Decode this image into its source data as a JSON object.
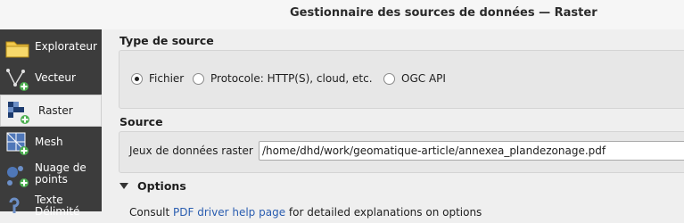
{
  "window": {
    "title": "Gestionnaire des sources de données — Raster"
  },
  "sidebar": {
    "items": [
      {
        "label": "Explorateur",
        "icon": "folder-icon",
        "selected": false
      },
      {
        "label": "Vecteur",
        "icon": "vector-layer-icon",
        "selected": false
      },
      {
        "label": "Raster",
        "icon": "raster-layer-icon",
        "selected": true
      },
      {
        "label": "Mesh",
        "icon": "mesh-layer-icon",
        "selected": false
      },
      {
        "label_line1": "Nuage de",
        "label_line2": "points",
        "icon": "point-cloud-icon",
        "selected": false
      },
      {
        "label_line1": "Texte",
        "label_line2": "Délimité",
        "icon": "delimited-text-icon",
        "selected": false
      }
    ]
  },
  "source_type": {
    "title": "Type de source",
    "options": [
      {
        "label": "Fichier",
        "checked": true
      },
      {
        "label": "Protocole: HTTP(S), cloud, etc.",
        "checked": false
      },
      {
        "label": "OGC API",
        "checked": false
      }
    ]
  },
  "source": {
    "title": "Source",
    "dataset_label": "Jeux de données raster",
    "dataset_value": "/home/dhd/work/geomatique-article/annexea_plandezonage.pdf"
  },
  "options": {
    "title": "Options",
    "help_prefix": "Consult ",
    "help_link": "PDF driver help page",
    "help_suffix": " for detailed explanations on options"
  },
  "colors": {
    "sidebar_bg": "#3c3c3c",
    "link": "#2a5db0",
    "folder": "#f2c94c"
  }
}
